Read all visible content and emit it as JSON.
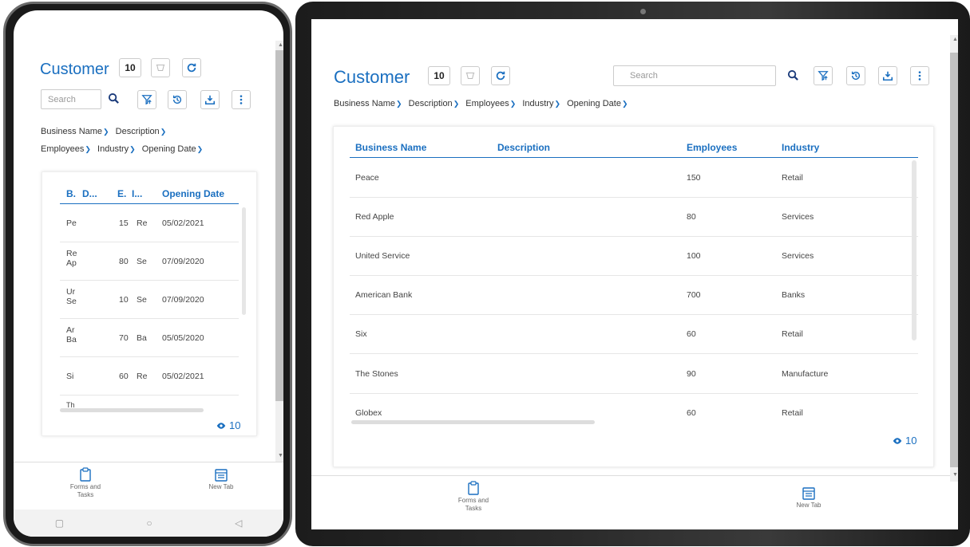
{
  "app": {
    "title": "Customer",
    "record_count": "10",
    "search_placeholder": "Search",
    "visible_count": "10"
  },
  "filters": [
    "Business Name",
    "Description",
    "Employees",
    "Industry",
    "Opening Date"
  ],
  "table": {
    "columns": {
      "business_name": "Business Name",
      "description": "Description",
      "employees": "Employees",
      "industry": "Industry",
      "opening_date": "Opening Date"
    },
    "phone_columns": [
      "B.",
      "D...",
      "E.",
      "I...",
      "Opening Date"
    ],
    "rows": [
      {
        "business_name": "Peace",
        "employees": "150",
        "industry": "Retail",
        "opening_date": "05/02/2021"
      },
      {
        "business_name": "Red Apple",
        "employees": "80",
        "industry": "Services",
        "opening_date": "07/09/2020"
      },
      {
        "business_name": "United Service",
        "employees": "100",
        "industry": "Services",
        "opening_date": "07/09/2020"
      },
      {
        "business_name": "American Bank",
        "employees": "700",
        "industry": "Banks",
        "opening_date": "05/05/2020"
      },
      {
        "business_name": "Six",
        "employees": "60",
        "industry": "Retail",
        "opening_date": "05/02/2021"
      },
      {
        "business_name": "The Stones",
        "employees": "90",
        "industry": "Manufacture"
      },
      {
        "business_name": "Globex",
        "employees": "60",
        "industry": "Retail"
      }
    ],
    "phone_rows": [
      {
        "b1": "Pe",
        "b2": "",
        "e": "15",
        "i": "Re",
        "date": "05/02/2021"
      },
      {
        "b1": "Re",
        "b2": "Ap",
        "e": "80",
        "i": "Se",
        "date": "07/09/2020"
      },
      {
        "b1": "Ur",
        "b2": "Se",
        "e": "10",
        "i": "Se",
        "date": "07/09/2020"
      },
      {
        "b1": "Ar",
        "b2": "Ba",
        "e": "70",
        "i": "Ba",
        "date": "05/05/2020"
      },
      {
        "b1": "Si",
        "b2": "",
        "e": "60",
        "i": "Re",
        "date": "05/02/2021"
      },
      {
        "b1": "Th",
        "b2": "",
        "e": "",
        "i": "",
        "date": ""
      }
    ]
  },
  "bottom_nav": {
    "forms_label": "Forms and Tasks",
    "new_tab_label": "New Tab"
  },
  "colors": {
    "accent": "#1a6fc0",
    "header_text": "#1a6fc0"
  }
}
